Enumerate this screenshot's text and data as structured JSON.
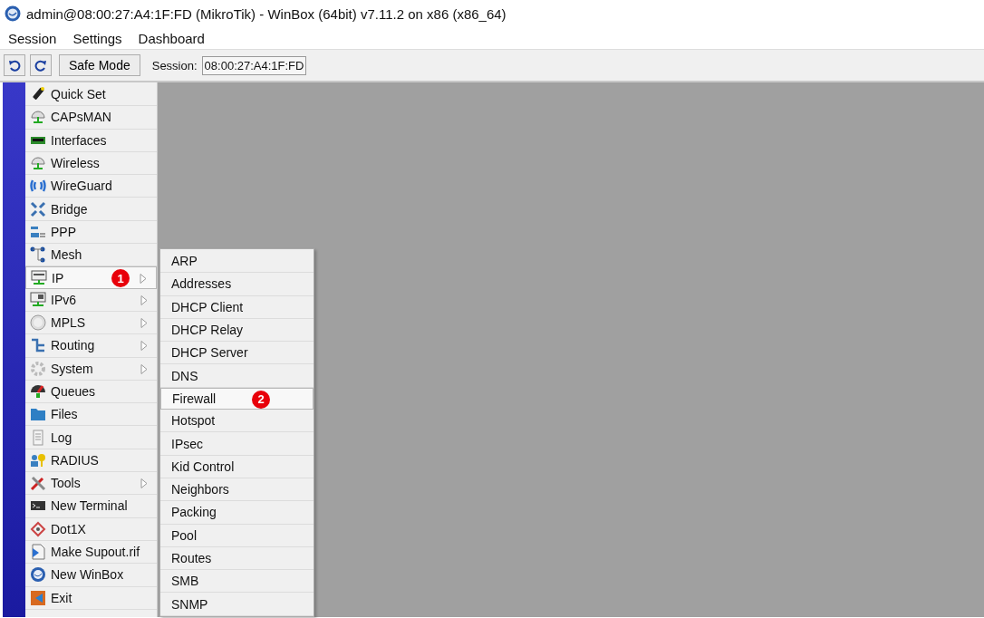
{
  "window": {
    "title": "admin@08:00:27:A4:1F:FD (MikroTik) - WinBox (64bit) v7.11.2 on x86 (x86_64)"
  },
  "menu_bar": [
    "Session",
    "Settings",
    "Dashboard"
  ],
  "toolbar": {
    "safe_mode": "Safe Mode",
    "session_label": "Session:",
    "session_value": "08:00:27:A4:1F:FD"
  },
  "sidebar": {
    "items": [
      {
        "label": "Quick Set",
        "has_submenu": false,
        "selected": false
      },
      {
        "label": "CAPsMAN",
        "has_submenu": false,
        "selected": false
      },
      {
        "label": "Interfaces",
        "has_submenu": false,
        "selected": false
      },
      {
        "label": "Wireless",
        "has_submenu": false,
        "selected": false
      },
      {
        "label": "WireGuard",
        "has_submenu": false,
        "selected": false
      },
      {
        "label": "Bridge",
        "has_submenu": false,
        "selected": false
      },
      {
        "label": "PPP",
        "has_submenu": false,
        "selected": false
      },
      {
        "label": "Mesh",
        "has_submenu": false,
        "selected": false
      },
      {
        "label": "IP",
        "has_submenu": true,
        "selected": true,
        "badge": "1"
      },
      {
        "label": "IPv6",
        "has_submenu": true,
        "selected": false
      },
      {
        "label": "MPLS",
        "has_submenu": true,
        "selected": false
      },
      {
        "label": "Routing",
        "has_submenu": true,
        "selected": false
      },
      {
        "label": "System",
        "has_submenu": true,
        "selected": false
      },
      {
        "label": "Queues",
        "has_submenu": false,
        "selected": false
      },
      {
        "label": "Files",
        "has_submenu": false,
        "selected": false
      },
      {
        "label": "Log",
        "has_submenu": false,
        "selected": false
      },
      {
        "label": "RADIUS",
        "has_submenu": false,
        "selected": false
      },
      {
        "label": "Tools",
        "has_submenu": true,
        "selected": false
      },
      {
        "label": "New Terminal",
        "has_submenu": false,
        "selected": false
      },
      {
        "label": "Dot1X",
        "has_submenu": false,
        "selected": false
      },
      {
        "label": "Make Supout.rif",
        "has_submenu": false,
        "selected": false
      },
      {
        "label": "New WinBox",
        "has_submenu": false,
        "selected": false
      },
      {
        "label": "Exit",
        "has_submenu": false,
        "selected": false
      }
    ]
  },
  "submenu": {
    "items": [
      {
        "label": "ARP",
        "selected": false
      },
      {
        "label": "Addresses",
        "selected": false
      },
      {
        "label": "DHCP Client",
        "selected": false
      },
      {
        "label": "DHCP Relay",
        "selected": false
      },
      {
        "label": "DHCP Server",
        "selected": false
      },
      {
        "label": "DNS",
        "selected": false
      },
      {
        "label": "Firewall",
        "selected": true,
        "badge": "2"
      },
      {
        "label": "Hotspot",
        "selected": false
      },
      {
        "label": "IPsec",
        "selected": false
      },
      {
        "label": "Kid Control",
        "selected": false
      },
      {
        "label": "Neighbors",
        "selected": false
      },
      {
        "label": "Packing",
        "selected": false
      },
      {
        "label": "Pool",
        "selected": false
      },
      {
        "label": "Routes",
        "selected": false
      },
      {
        "label": "SMB",
        "selected": false
      },
      {
        "label": "SNMP",
        "selected": false
      }
    ]
  }
}
